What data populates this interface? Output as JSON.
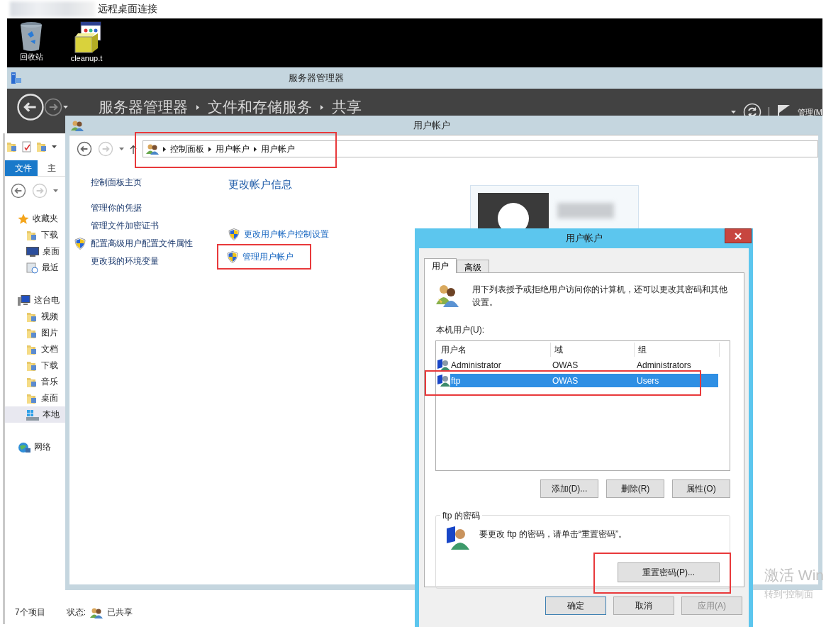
{
  "remote_desktop": {
    "title": "远程桌面连接"
  },
  "desktop_icons": [
    {
      "label": "回收站",
      "kind": "recycle-bin"
    },
    {
      "label": "cleanup.t",
      "kind": "installer"
    }
  ],
  "server_manager": {
    "title": "服务器管理器",
    "breadcrumb": [
      "服务器管理器",
      "文件和存储服务",
      "共享"
    ],
    "menu": "管理(M"
  },
  "explorer": {
    "ribbon_tabs": [
      {
        "label": "文件",
        "selected": true
      },
      {
        "label": "主",
        "selected": false
      }
    ],
    "tree": [
      {
        "label": "收藏夹",
        "kind": "star",
        "selected": false,
        "children": [
          {
            "label": "下载",
            "kind": "folder",
            "selected": false
          },
          {
            "label": "桌面",
            "kind": "desktop",
            "selected": false
          },
          {
            "label": "最近",
            "kind": "recent",
            "selected": false
          }
        ]
      },
      {
        "label": "这台电",
        "kind": "computer",
        "selected": false,
        "children": [
          {
            "label": "视频",
            "kind": "folder",
            "selected": false
          },
          {
            "label": "图片",
            "kind": "folder",
            "selected": false
          },
          {
            "label": "文档",
            "kind": "folder",
            "selected": false
          },
          {
            "label": "下载",
            "kind": "folder",
            "selected": false
          },
          {
            "label": "音乐",
            "kind": "folder",
            "selected": false
          },
          {
            "label": "桌面",
            "kind": "folder",
            "selected": false
          },
          {
            "label": "本地",
            "kind": "disk",
            "selected": true
          }
        ]
      },
      {
        "label": "网络",
        "kind": "network",
        "selected": false
      }
    ],
    "status": {
      "count": "7个项目",
      "state_label": "状态:",
      "state": "已共享"
    }
  },
  "control_panel": {
    "title": "用户帐户",
    "address": {
      "crumbs": [
        "控制面板",
        "用户帐户",
        "用户帐户"
      ],
      "highlighted": true
    },
    "side_links": [
      {
        "label": "控制面板主页",
        "shield": false
      },
      {
        "label": "管理你的凭据",
        "shield": false
      },
      {
        "label": "管理文件加密证书",
        "shield": false
      },
      {
        "label": "配置高级用户配置文件属性",
        "shield": true
      },
      {
        "label": "更改我的环境变量",
        "shield": false
      }
    ],
    "heading": "更改帐户信息",
    "task_links": [
      {
        "label": "更改用户帐户控制设置",
        "highlighted": false
      },
      {
        "label": "管理用户帐户",
        "highlighted": true
      }
    ]
  },
  "dialog": {
    "title": "用户帐户",
    "tabs": [
      {
        "label": "用户",
        "selected": true
      },
      {
        "label": "高级",
        "selected": false
      }
    ],
    "description": "用下列表授予或拒绝用户访问你的计算机，还可以更改其密码和其他设置。",
    "list_label": "本机用户(U):",
    "columns": [
      "用户名",
      "域",
      "组"
    ],
    "rows": [
      {
        "cells": [
          "Administrator",
          "OWAS",
          "Administrators"
        ],
        "selected": false,
        "highlighted": false
      },
      {
        "cells": [
          "ftp",
          "OWAS",
          "Users"
        ],
        "selected": true,
        "highlighted": true
      }
    ],
    "list_buttons": [
      "添加(D)...",
      "删除(R)",
      "属性(O)"
    ],
    "password_group": {
      "title": "ftp 的密码",
      "text": "要更改 ftp 的密码，请单击“重置密码”。",
      "button": {
        "label": "重置密码(P)...",
        "highlighted": true
      }
    },
    "footer_buttons": [
      {
        "label": "确定",
        "disabled": false,
        "default": true
      },
      {
        "label": "取消",
        "disabled": false,
        "default": false
      },
      {
        "label": "应用(A)",
        "disabled": true,
        "default": false
      }
    ]
  },
  "activation": {
    "title": "激活 Win",
    "subtitle": "转到“控制面"
  }
}
